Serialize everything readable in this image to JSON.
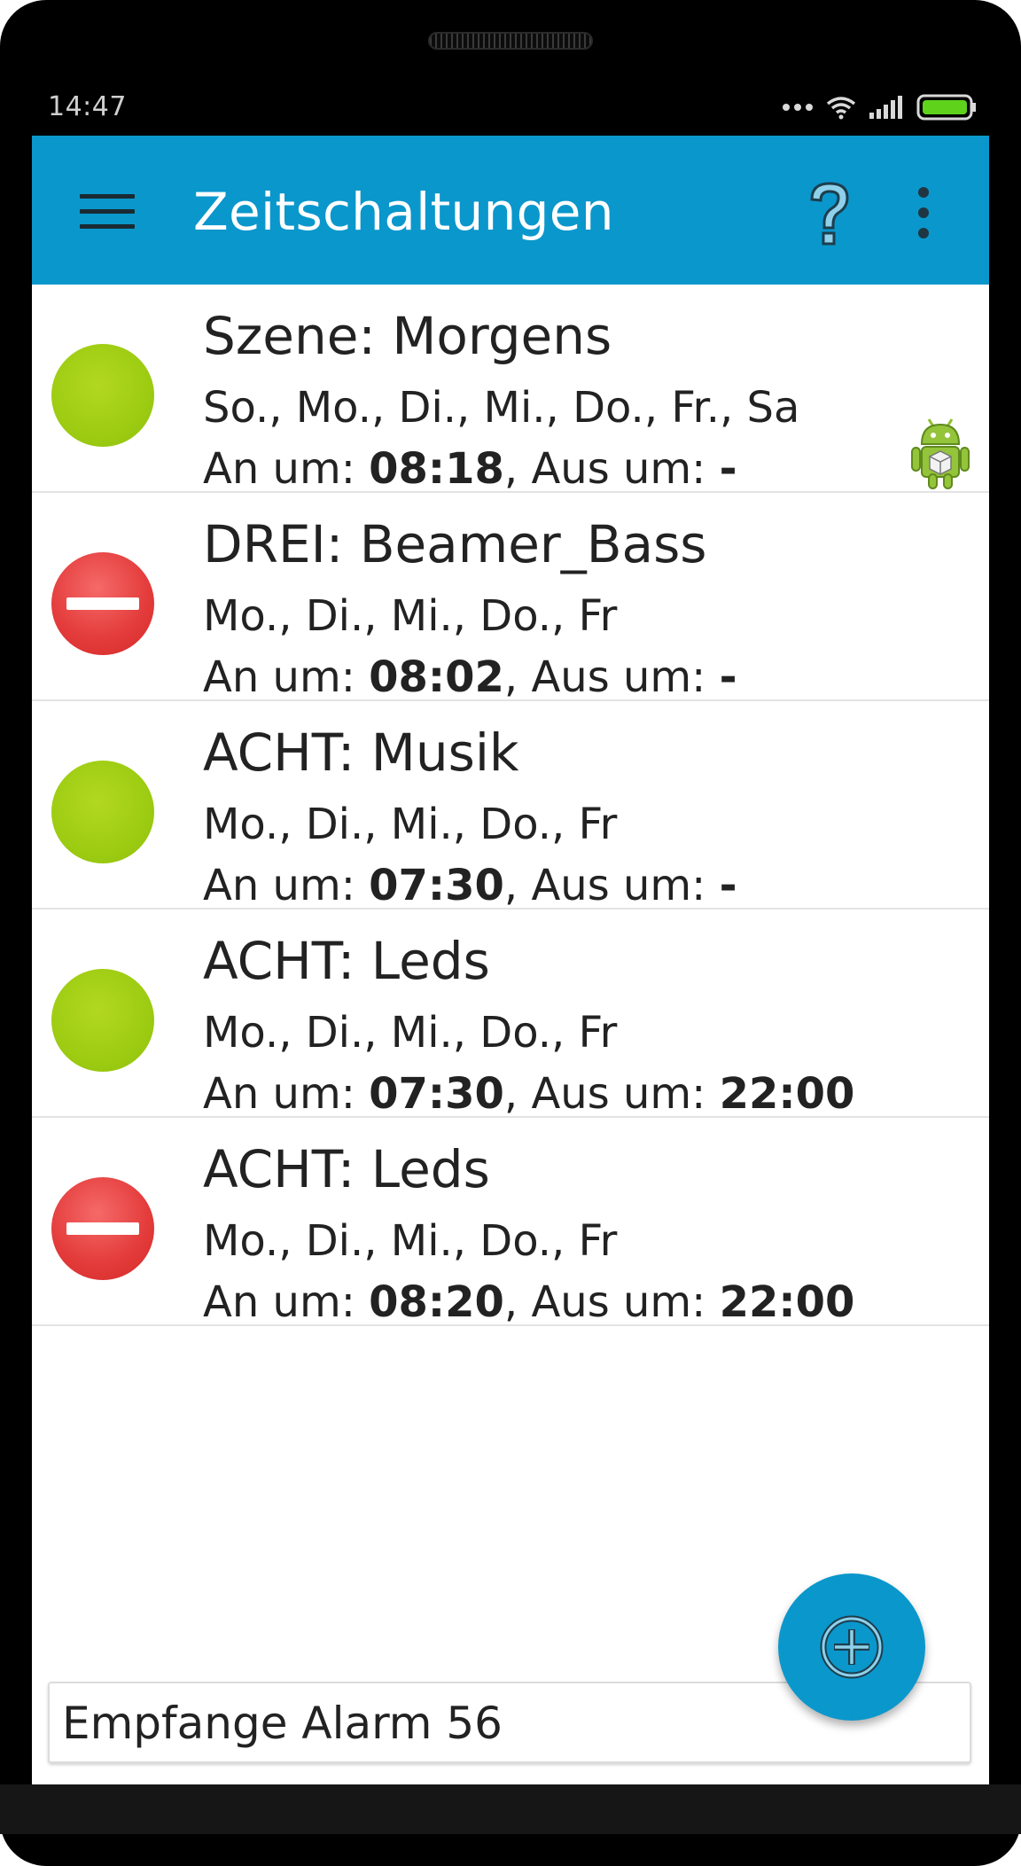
{
  "status_bar": {
    "time": "14:47",
    "icons": [
      "more-dots-icon",
      "wifi-icon",
      "signal-icon",
      "battery-icon"
    ],
    "battery_color": "#5fd31c"
  },
  "app_bar": {
    "title": "Zeitschaltungen",
    "background_color": "#0a97cc",
    "icons": [
      "menu-icon",
      "help-icon",
      "overflow-menu-icon"
    ]
  },
  "timers": [
    {
      "title": "Szene: Morgens",
      "days": "So., Mo., Di., Mi., Do., Fr., Sa",
      "on_label": "An um: ",
      "on_time": "08:18",
      "off_label": ", Aus um: ",
      "off_time": "-",
      "state": "active",
      "state_color": "#9dcc12"
    },
    {
      "title": "DREI: Beamer_Bass",
      "days": "Mo., Di., Mi., Do., Fr",
      "on_label": "An um: ",
      "on_time": "08:02",
      "off_label": ", Aus um: ",
      "off_time": "-",
      "state": "disabled",
      "state_color": "#e33a3a"
    },
    {
      "title": "ACHT: Musik",
      "days": "Mo., Di., Mi., Do., Fr",
      "on_label": "An um: ",
      "on_time": "07:30",
      "off_label": ", Aus um: ",
      "off_time": "-",
      "state": "active",
      "state_color": "#9dcc12"
    },
    {
      "title": "ACHT: Leds",
      "days": "Mo., Di., Mi., Do., Fr",
      "on_label": "An um: ",
      "on_time": "07:30",
      "off_label": ", Aus um: ",
      "off_time": "22:00",
      "state": "active",
      "state_color": "#9dcc12"
    },
    {
      "title": "ACHT: Leds",
      "days": "Mo., Di., Mi., Do., Fr",
      "on_label": "An um: ",
      "on_time": "08:20",
      "off_label": ", Aus um: ",
      "off_time": "22:00",
      "state": "disabled",
      "state_color": "#e33a3a"
    }
  ],
  "alarm_status": {
    "text": "Empfange Alarm 56"
  },
  "fab": {
    "icon": "add-circle-icon",
    "color": "#0a97cc"
  }
}
